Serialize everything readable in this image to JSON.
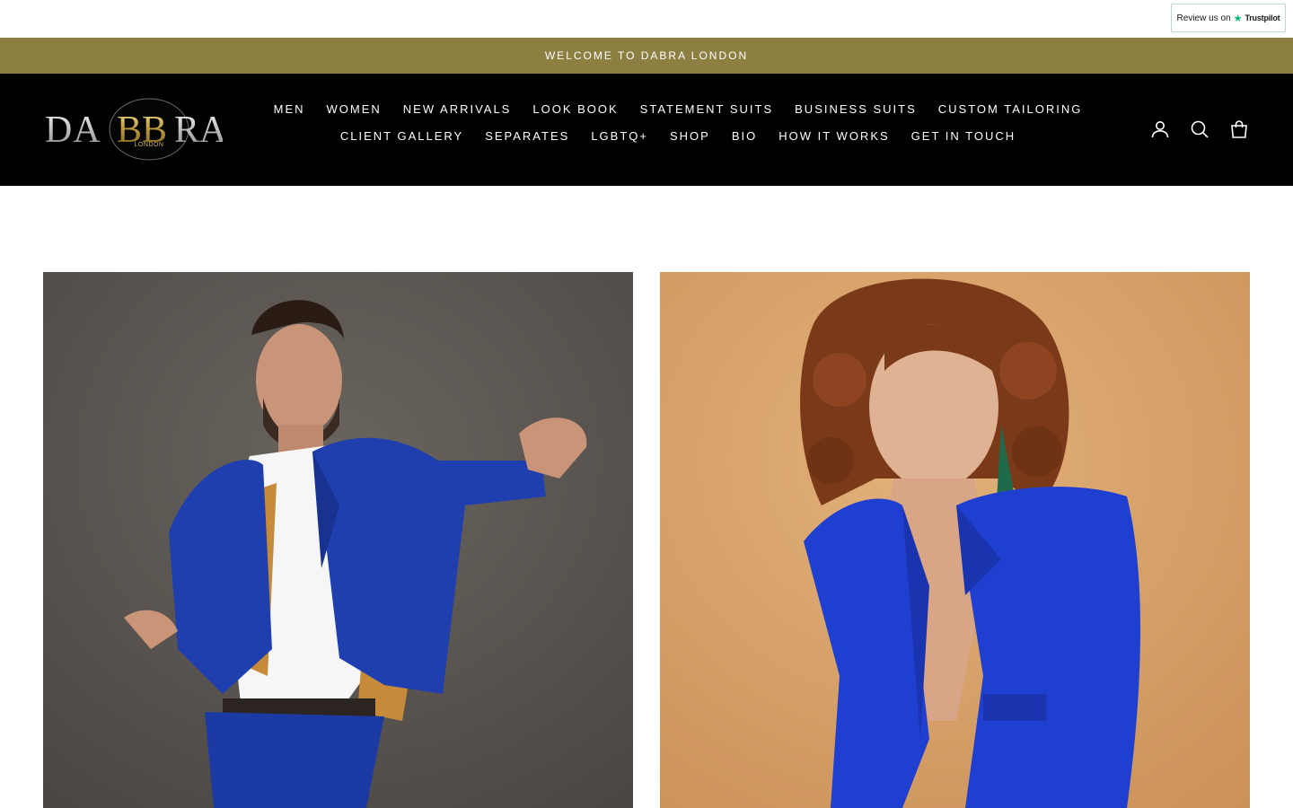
{
  "trustpilot": {
    "review_text": "Review us on",
    "brand": "Trustpilot",
    "star": "★"
  },
  "announcement": {
    "text": "WELCOME TO DABRA LONDON"
  },
  "logo": {
    "wordmark": "DABRA",
    "subtitle": "LONDON"
  },
  "nav": {
    "row1": [
      "MEN",
      "WOMEN",
      "NEW ARRIVALS",
      "LOOK BOOK",
      "STATEMENT SUITS",
      "BUSINESS SUITS",
      "CUSTOM TAILORING"
    ],
    "row2": [
      "CLIENT GALLERY",
      "SEPARATES",
      "LGBTQ+",
      "SHOP",
      "BIO",
      "HOW IT WORKS",
      "GET IN TOUCH"
    ]
  },
  "header_icons": [
    "account-icon",
    "search-icon",
    "cart-icon"
  ],
  "tiles": [
    {
      "name": "men-collection-tile",
      "image": "man in royal blue suit with gold lining",
      "background": "#5f5a55"
    },
    {
      "name": "women-collection-tile",
      "image": "woman with curly hair in royal blue blazer",
      "background": "#d9a66c"
    }
  ],
  "colors": {
    "announcement_bg": "#8c7f41",
    "header_bg": "#000000",
    "accent_blue": "#1f3fae"
  }
}
